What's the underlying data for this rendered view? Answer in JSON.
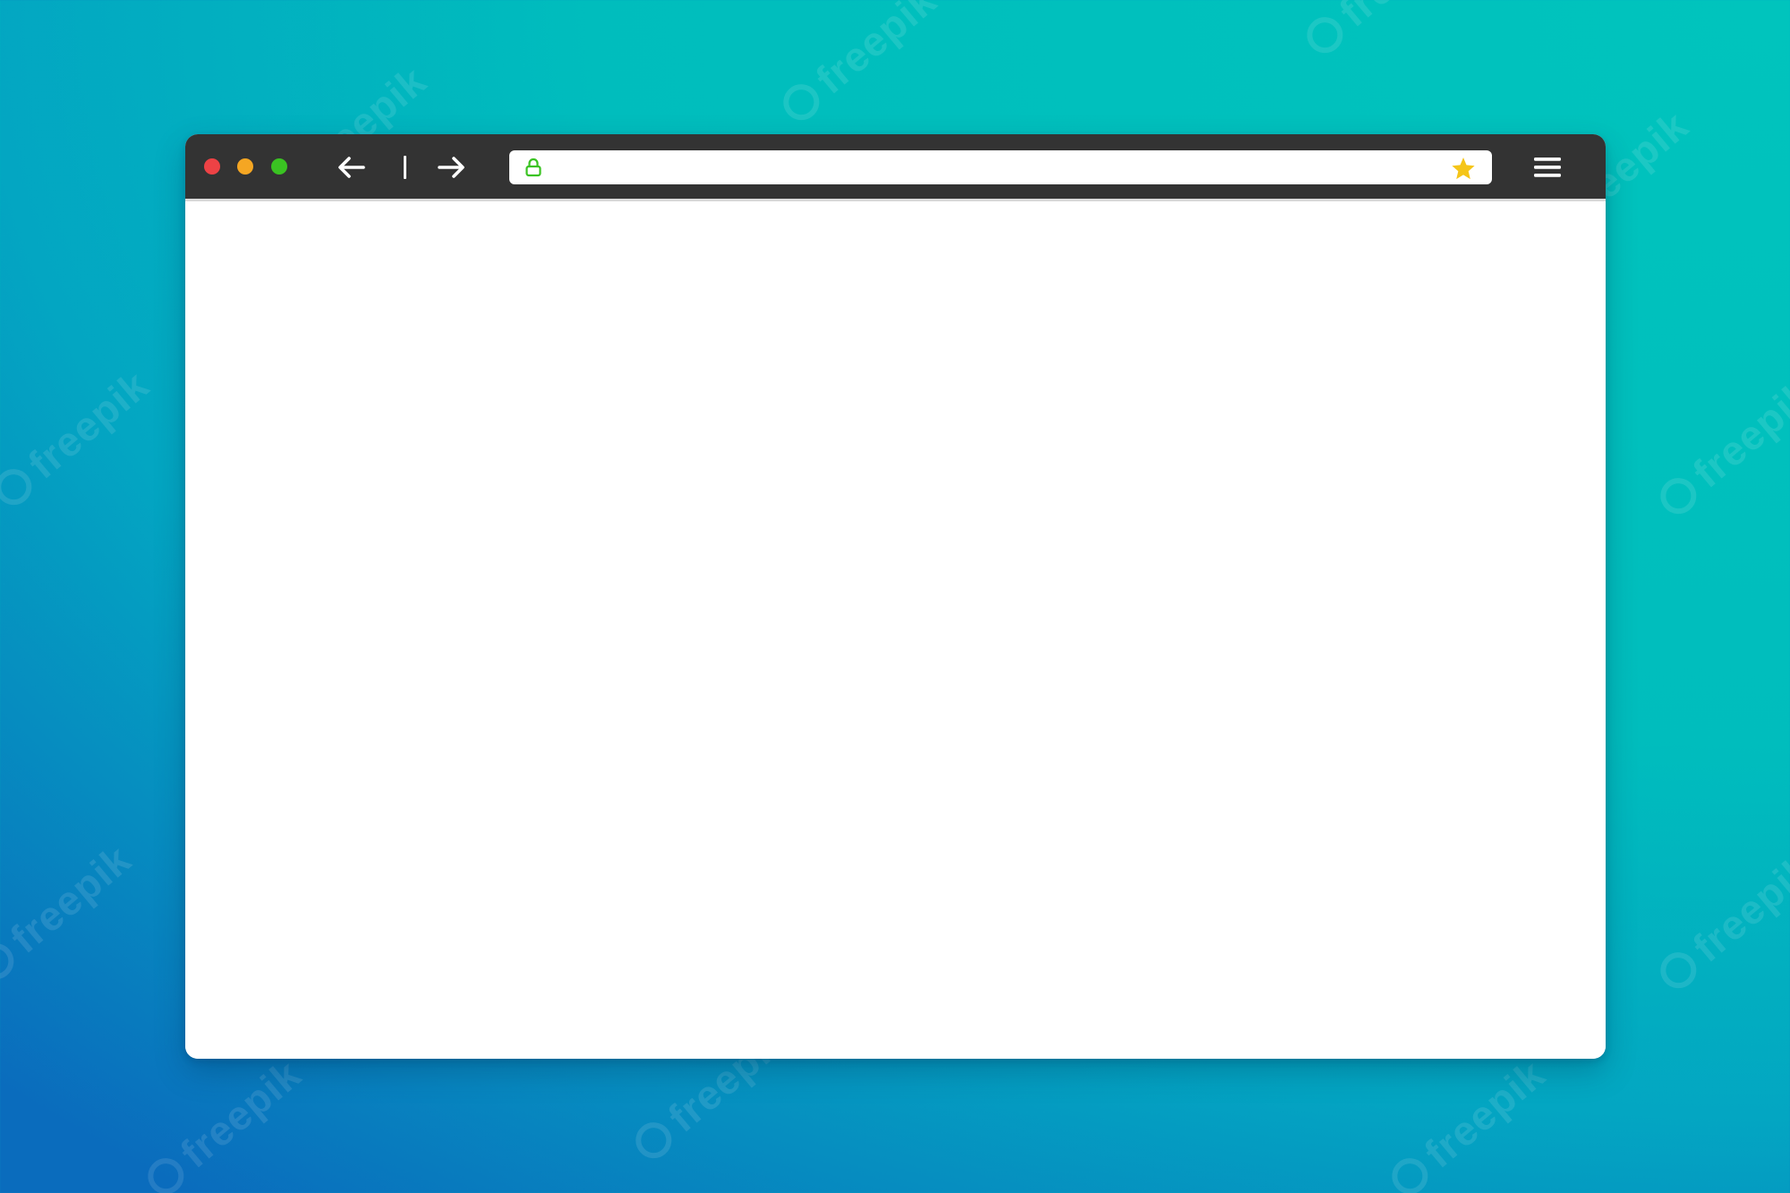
{
  "background": {
    "colors": {
      "teal": "#00bdbd",
      "blue": "#0a6cbd"
    },
    "watermark_text": "freepik"
  },
  "browser": {
    "titlebar_color": "#333333",
    "traffic_lights": [
      {
        "name": "close",
        "color": "#ed4245"
      },
      {
        "name": "minimize",
        "color": "#f5a623"
      },
      {
        "name": "maximize",
        "color": "#3ac322"
      }
    ],
    "toolbar": {
      "back_icon": "arrow-left-icon",
      "forward_icon": "arrow-right-icon",
      "menu_icon": "hamburger-menu-icon"
    },
    "address_bar": {
      "value": "",
      "placeholder": "",
      "lock_icon": "lock-icon",
      "lock_color": "#3ac322",
      "bookmark_icon": "star-icon",
      "bookmark_color": "#f5c518"
    },
    "content": {
      "background": "#ffffff"
    }
  }
}
